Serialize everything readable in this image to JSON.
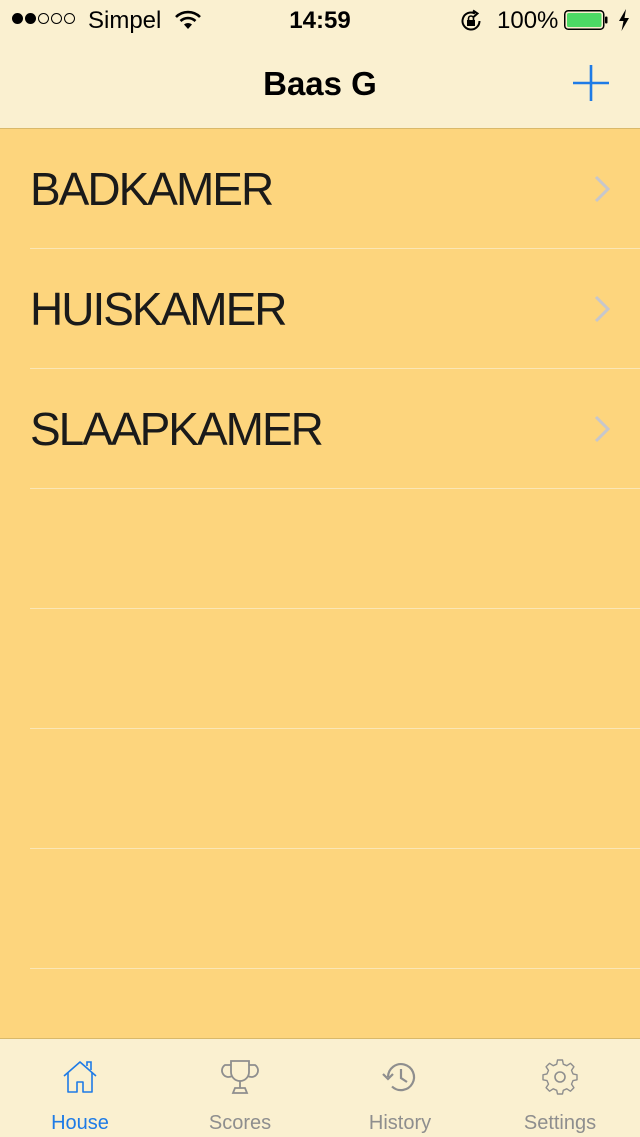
{
  "status_bar": {
    "carrier": "Simpel",
    "time": "14:59",
    "battery": "100%",
    "signal_strength": 2,
    "signal_max": 5
  },
  "nav": {
    "title": "Baas G",
    "add_icon": "plus-icon"
  },
  "rooms": [
    {
      "label": "BADKAMER"
    },
    {
      "label": "HUISKAMER"
    },
    {
      "label": "SLAAPKAMER"
    }
  ],
  "tabs": [
    {
      "label": "House",
      "icon": "house-icon",
      "active": true
    },
    {
      "label": "Scores",
      "icon": "trophy-icon",
      "active": false
    },
    {
      "label": "History",
      "icon": "history-icon",
      "active": false
    },
    {
      "label": "Settings",
      "icon": "gear-icon",
      "active": false
    }
  ],
  "colors": {
    "background": "#FDD57D",
    "bar": "#FAF0D0",
    "accent": "#1E7BE6",
    "inactive": "#8E8E8E"
  }
}
